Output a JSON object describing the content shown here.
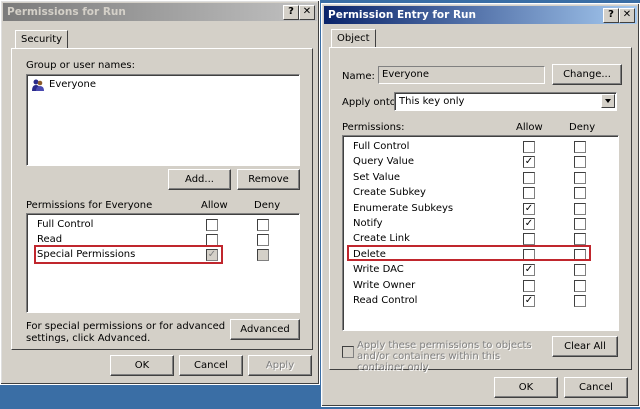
{
  "left": {
    "title": "Permissions for Run",
    "help_btn": "?",
    "close_btn": "✕",
    "tab": "Security",
    "group_label": "Group or user names:",
    "users": [
      "Everyone"
    ],
    "add_btn": "Add...",
    "remove_btn": "Remove",
    "perm_header": "Permissions for Everyone",
    "allow_header": "Allow",
    "deny_header": "Deny",
    "permissions": [
      {
        "name": "Full Control",
        "allow": false,
        "deny": false
      },
      {
        "name": "Read",
        "allow": false,
        "deny": false
      },
      {
        "name": "Special Permissions",
        "allow": "grey-check",
        "deny": "grey"
      }
    ],
    "special_note": "For special permissions or for advanced settings, click Advanced.",
    "advanced_btn": "Advanced",
    "ok_btn": "OK",
    "cancel_btn": "Cancel",
    "apply_btn": "Apply"
  },
  "right": {
    "title": "Permission Entry for Run",
    "help_btn": "?",
    "close_btn": "✕",
    "tab": "Object",
    "name_label": "Name:",
    "name_value": "Everyone",
    "change_btn": "Change...",
    "apply_onto_label": "Apply onto:",
    "apply_onto_value": "This key only",
    "perm_label": "Permissions:",
    "allow_header": "Allow",
    "deny_header": "Deny",
    "permissions": [
      {
        "name": "Full Control",
        "allow": false,
        "deny": false
      },
      {
        "name": "Query Value",
        "allow": true,
        "deny": false
      },
      {
        "name": "Set Value",
        "allow": false,
        "deny": false
      },
      {
        "name": "Create Subkey",
        "allow": false,
        "deny": false
      },
      {
        "name": "Enumerate Subkeys",
        "allow": true,
        "deny": false
      },
      {
        "name": "Notify",
        "allow": true,
        "deny": false
      },
      {
        "name": "Create Link",
        "allow": false,
        "deny": false
      },
      {
        "name": "Delete",
        "allow": false,
        "deny": false
      },
      {
        "name": "Write DAC",
        "allow": true,
        "deny": false
      },
      {
        "name": "Write Owner",
        "allow": false,
        "deny": false
      },
      {
        "name": "Read Control",
        "allow": true,
        "deny": false
      }
    ],
    "apply_check_label": "Apply these permissions to objects and/or containers within this container only",
    "clear_all_btn": "Clear All",
    "ok_btn": "OK",
    "cancel_btn": "Cancel"
  }
}
